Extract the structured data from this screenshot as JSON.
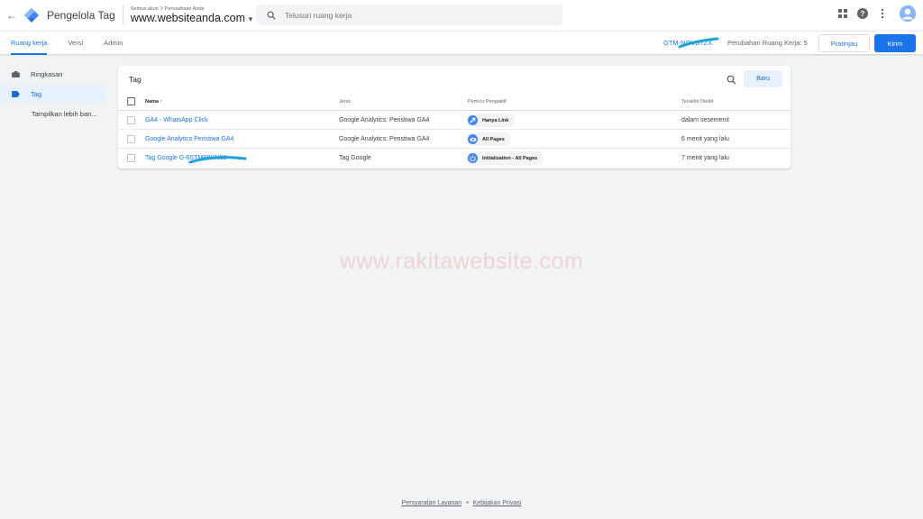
{
  "header": {
    "app_name": "Pengelola Tag",
    "breadcrumb": "Semua akun ᐳ Perusahaan Anda",
    "account_name": "www.websiteanda.com",
    "search_placeholder": "Telusuri ruang kerja"
  },
  "subnav": {
    "tabs": [
      {
        "label": "Ruang kerja",
        "active": true
      },
      {
        "label": "Versi",
        "active": false
      },
      {
        "label": "Admin",
        "active": false
      }
    ],
    "container_id": "GTM-NOVB7ZX",
    "workspace_changes_label": "Perubahan Ruang Kerja:",
    "workspace_changes_count": "5",
    "preview_label": "Pratinjau",
    "submit_label": "Kirim"
  },
  "sidebar": {
    "items": [
      {
        "label": "Ringkasan",
        "icon": "briefcase-icon",
        "active": false
      },
      {
        "label": "Tag",
        "icon": "tag-icon",
        "active": true
      }
    ],
    "more_label": "Tampilkan lebih ban..."
  },
  "tags_card": {
    "title": "Tag",
    "new_button": "Baru",
    "columns": [
      "Nama",
      "Jenis",
      "Pemicu Pengaktif",
      "Terakhir Diedit"
    ],
    "sort_indicator": "↑",
    "rows": [
      {
        "name": "GA4 - WhatsApp Click",
        "type": "Google Analytics: Peristiwa GA4",
        "trigger": "Hanya Link",
        "trigger_icon": "link-icon",
        "edited": "dalam sesemenit"
      },
      {
        "name": "Google Analytics Peristiwa GA4",
        "type": "Google Analytics: Peristiwa GA4",
        "trigger": "All Pages",
        "trigger_icon": "eye-icon",
        "edited": "6 menit yang lalu"
      },
      {
        "name": "Tag Google G-6STM8BKN83",
        "type": "Tag Google",
        "trigger": "Initialization - All Pages",
        "trigger_icon": "power-icon",
        "edited": "7 menit yang lalu"
      }
    ]
  },
  "watermark": "www.rakitawebsite.com",
  "footer": {
    "terms": "Persyaratan Layanan",
    "separator": "•",
    "privacy": "Kebijakan Privasi"
  },
  "colors": {
    "accent": "#1a73e8",
    "chip_icon": "#4285f4",
    "scribble": "#1aa3dd",
    "background": "#f1f3f4"
  }
}
